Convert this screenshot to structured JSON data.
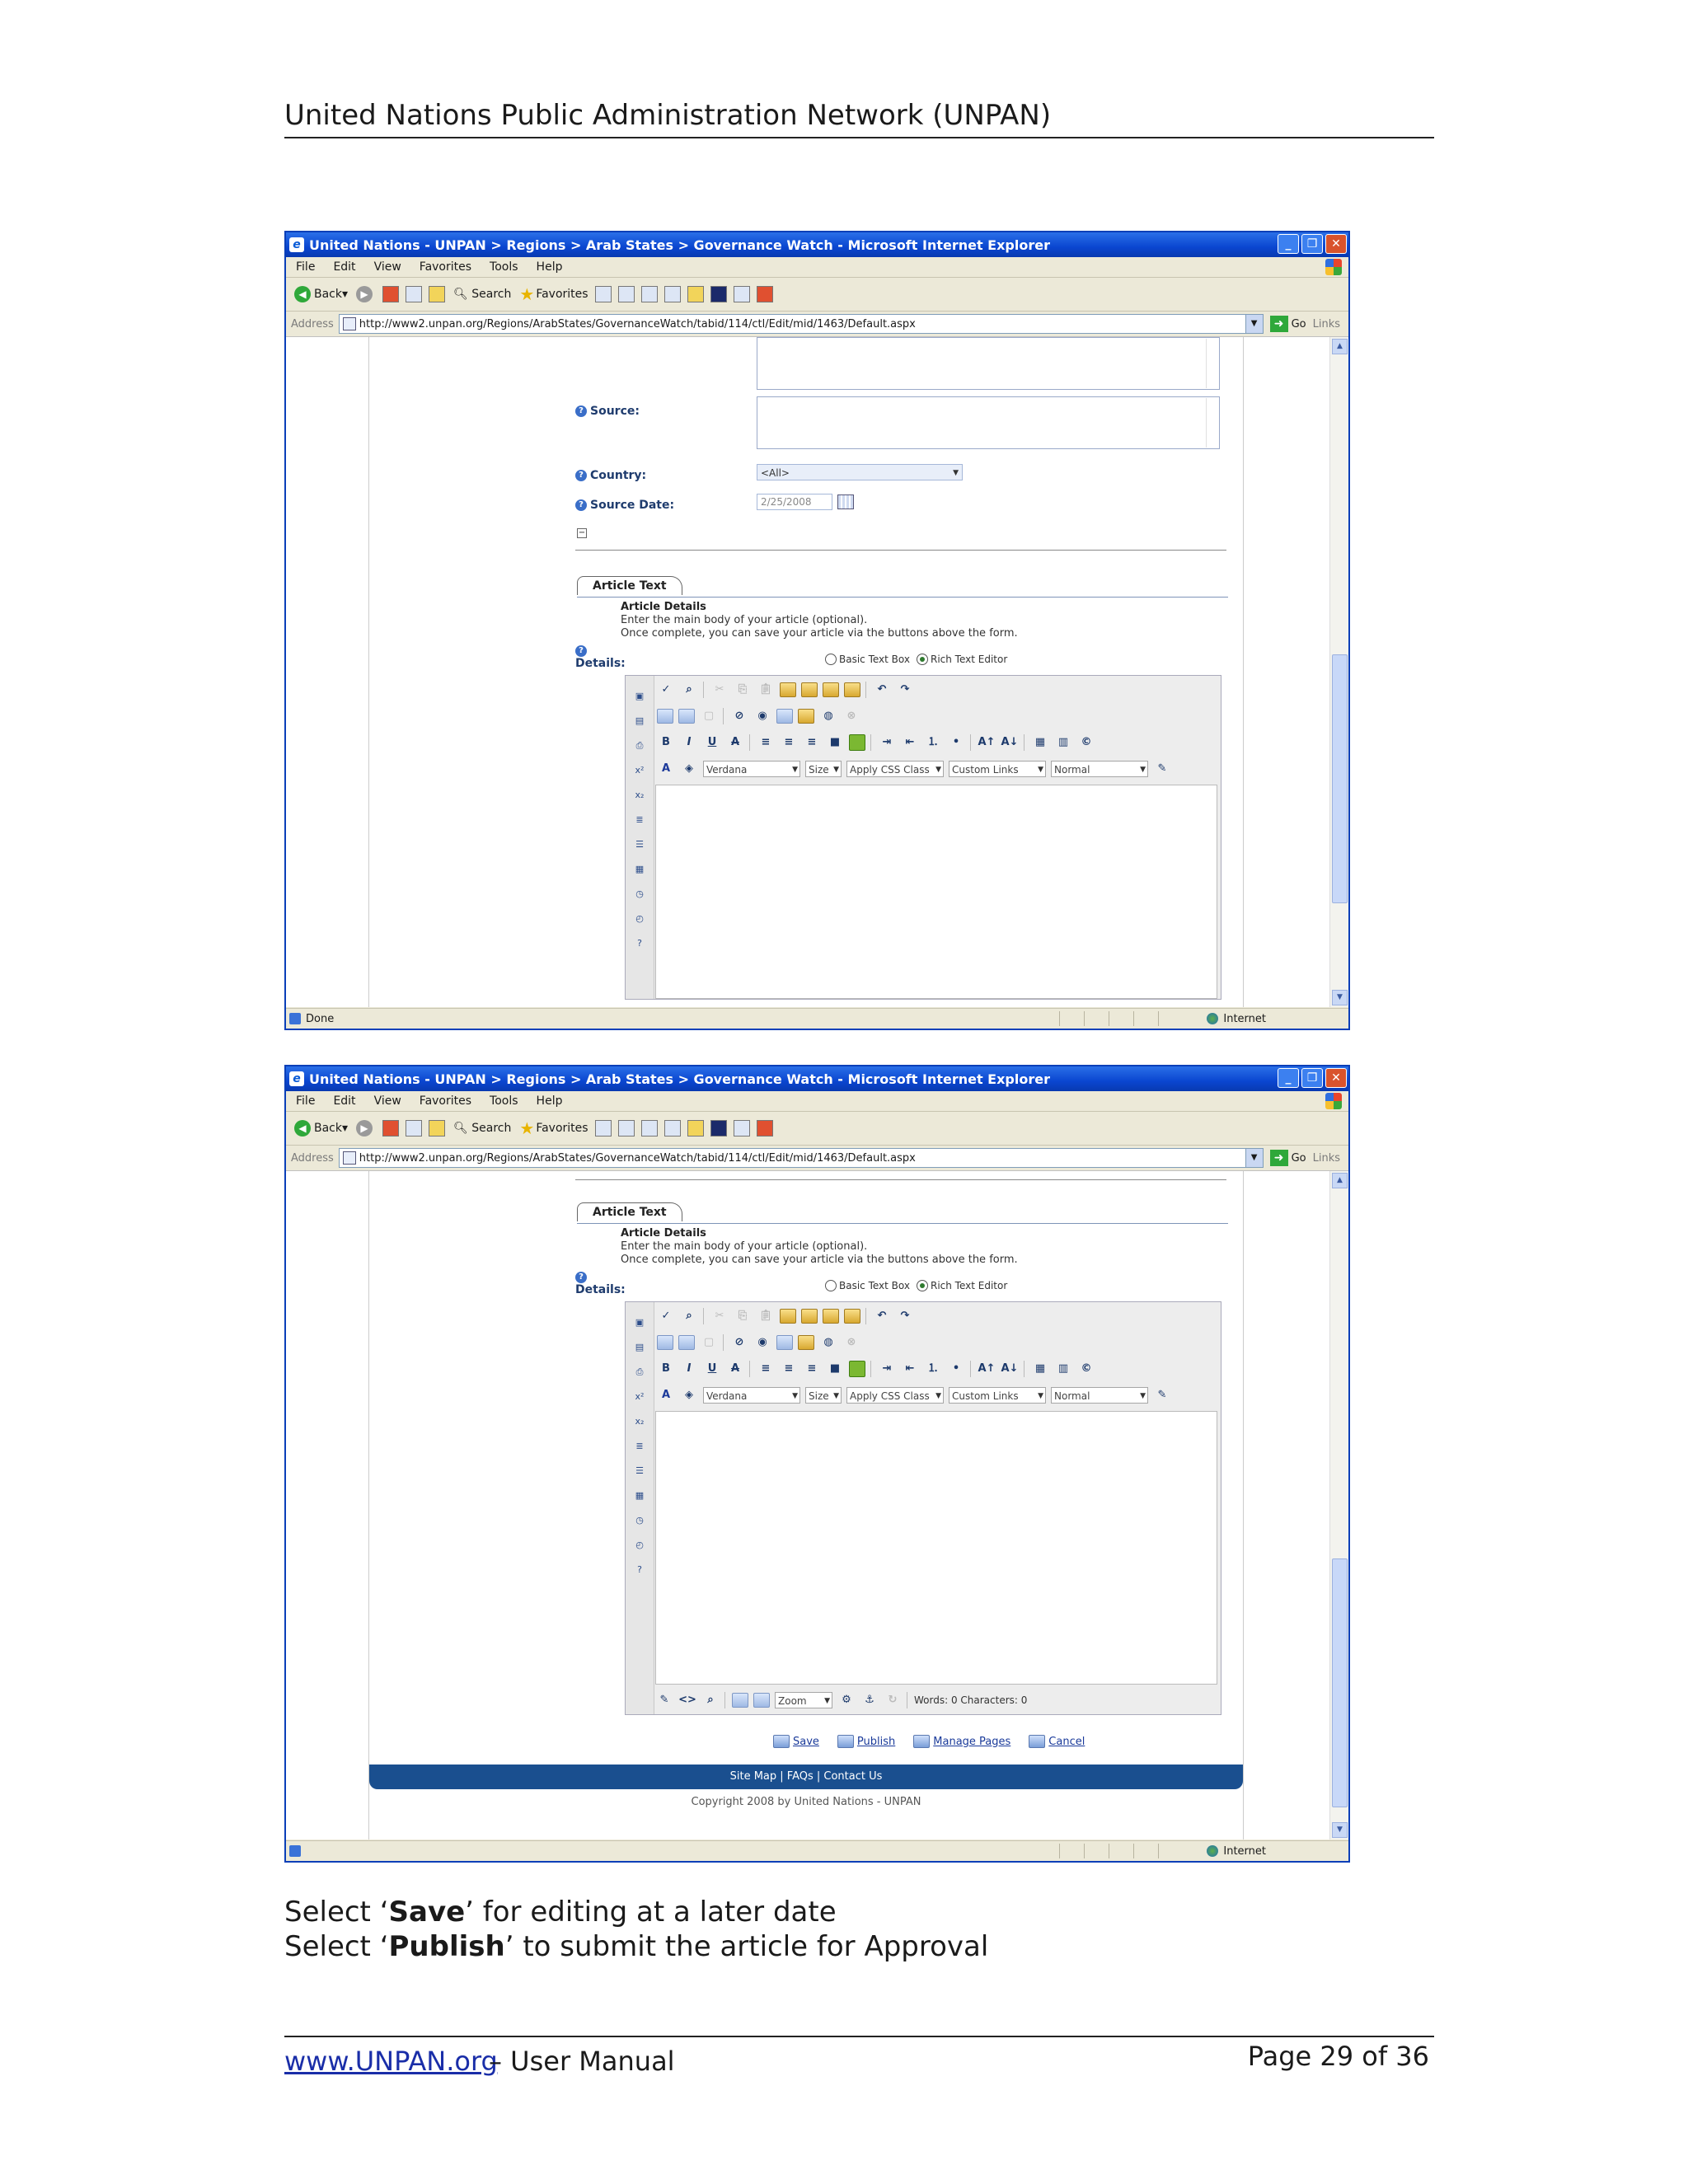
{
  "header": {
    "title": "United Nations Public Administration Network (UNPAN)"
  },
  "browser": {
    "title": "United Nations - UNPAN > Regions > Arab States > Governance Watch - Microsoft Internet Explorer",
    "menu": [
      "File",
      "Edit",
      "View",
      "Favorites",
      "Tools",
      "Help"
    ],
    "back_label": "Back",
    "search_label": "Search",
    "favorites_label": "Favorites",
    "address_label": "Address",
    "url": "http://www2.unpan.org/Regions/ArabStates/GovernanceWatch/tabid/114/ctl/Edit/mid/1463/Default.aspx",
    "go_label": "Go",
    "links_label": "Links",
    "status_done": "Done",
    "zone": "Internet"
  },
  "form": {
    "source_label": "Source:",
    "country_label": "Country:",
    "country_value": "<All>",
    "source_date_label": "Source Date:",
    "source_date_value": "2/25/2008",
    "tab_label": "Article Text",
    "section_title": "Article Details",
    "section_line1": "Enter the main body of your article (optional).",
    "section_line2": "Once complete, you can save your article via the buttons above the form.",
    "details_label": "Details:",
    "radio_basic": "Basic Text Box",
    "radio_rich": "Rich Text Editor"
  },
  "editor": {
    "font": "Verdana",
    "size": "Size",
    "css_class": "Apply CSS Class",
    "custom_links": "Custom Links",
    "paragraph": "Normal",
    "zoom": "Zoom",
    "word_count": "Words: 0 Characters: 0"
  },
  "actions": {
    "save": "Save",
    "publish": "Publish",
    "manage": "Manage Pages",
    "cancel": "Cancel"
  },
  "site_footer": {
    "links": "Site Map | FAQs | Contact Us",
    "copyright": "Copyright 2008 by United Nations - UNPAN"
  },
  "instructions": {
    "line1_pre": "Select ‘",
    "line1_bold": "Save",
    "line1_post": "’ for editing at a later date",
    "line2_pre": "Select ‘",
    "line2_bold": "Publish",
    "line2_post": "’ to submit the article for Approval"
  },
  "page_footer": {
    "link": "www.UNPAN.org",
    "suffix": "– User Manual",
    "page": "Page 29 of 36"
  }
}
